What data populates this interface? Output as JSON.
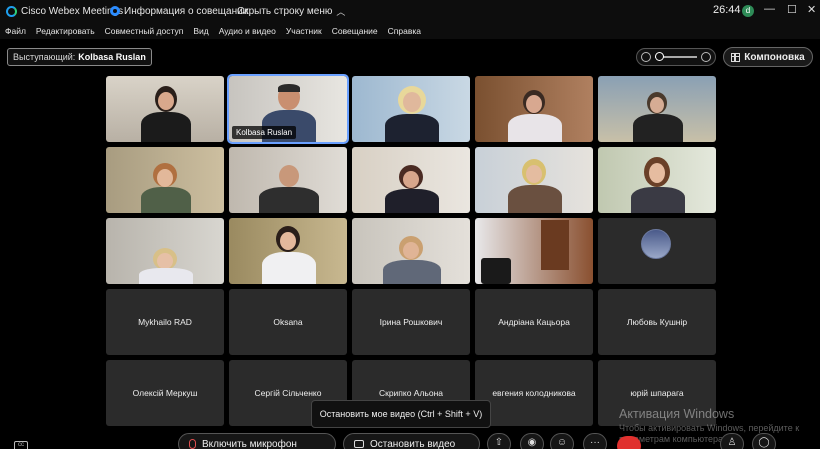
{
  "titlebar": {
    "app_name": "Cisco Webex Meetings",
    "info_label": "Информация о совещании",
    "hide_menu_label": "Скрыть строку меню",
    "time": "26:44",
    "avatar_letter": "d",
    "minimize": "—",
    "maximize": "☐",
    "close": "✕"
  },
  "menu": [
    "Файл",
    "Редактировать",
    "Совместный доступ",
    "Вид",
    "Аудио и видео",
    "Участник",
    "Совещание",
    "Справка"
  ],
  "speaker": {
    "label": "Выступающий:",
    "name": "Kolbasa Ruslan"
  },
  "layout_button": "Компоновка",
  "tiles": {
    "t1": "",
    "t2": "Kolbasa Ruslan",
    "n1": "Mykhailo RAD",
    "n2": "Oksana",
    "n3": "Ірина Рошкович",
    "n4": "Андріана Кацьора",
    "n5": "Любовь Кушнір",
    "n6": "Олексій Меркуш",
    "n7": "Сергій Сільченко",
    "n8": "Скрипко Альона",
    "n9": "евгения колодникова",
    "n10": "юрій шпарага"
  },
  "tooltip": "Остановить мое видео (Ctrl + Shift + V)",
  "bottombar": {
    "mute_label": "Включить микрофон",
    "video_label": "Остановить видео",
    "more": "···"
  },
  "watermark": {
    "title": "Активация Windows",
    "subtitle": "Чтобы активировать Windows, перейдите к параметрам компьютера."
  },
  "colors": {
    "accent": "#6aa0ff",
    "leave": "#e0302e",
    "muted": "#e25050"
  }
}
